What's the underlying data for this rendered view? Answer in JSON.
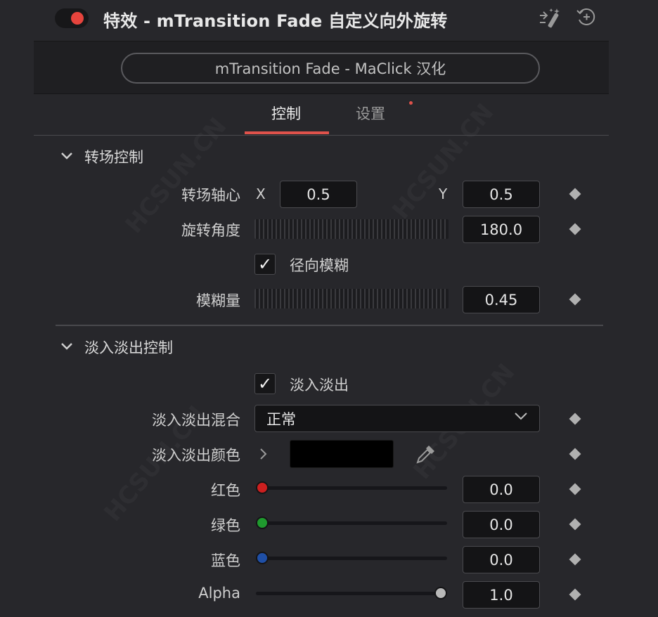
{
  "header": {
    "title": "特效 - mTransition Fade 自定义向外旋转",
    "enable_toggle_on": true,
    "icons": [
      "magic-wand-icon",
      "reset-icon"
    ]
  },
  "preset": {
    "label": "mTransition Fade - MaClick 汉化"
  },
  "tabs": [
    {
      "label": "控制",
      "active": true
    },
    {
      "label": "设置",
      "active": false
    }
  ],
  "transition_section": {
    "title": "转场控制",
    "pivot": {
      "label": "转场轴心",
      "x_label": "X",
      "x_value": "0.5",
      "y_label": "Y",
      "y_value": "0.5"
    },
    "rotation": {
      "label": "旋转角度",
      "value": "180.0"
    },
    "radial_blur": {
      "label": "径向模糊",
      "checked": true
    },
    "blur_amount": {
      "label": "模糊量",
      "value": "0.45"
    }
  },
  "fade_section": {
    "title": "淡入淡出控制",
    "fade_toggle": {
      "label": "淡入淡出",
      "checked": true
    },
    "blend": {
      "label": "淡入淡出混合",
      "value": "正常"
    },
    "color": {
      "label": "淡入淡出颜色",
      "swatch": "#000000"
    },
    "red": {
      "label": "红色",
      "value": "0.0",
      "knob_color": "#cc1f1f",
      "level": 0.0
    },
    "green": {
      "label": "绿色",
      "value": "0.0",
      "knob_color": "#1f9a2e",
      "level": 0.0
    },
    "blue": {
      "label": "蓝色",
      "value": "0.0",
      "knob_color": "#1f4fa6",
      "level": 0.0
    },
    "alpha": {
      "label": "Alpha",
      "value": "1.0",
      "knob_color": "#b8b8b8",
      "level": 1.0
    }
  },
  "colors": {
    "accent": "#e0524b",
    "background": "#27272b"
  }
}
